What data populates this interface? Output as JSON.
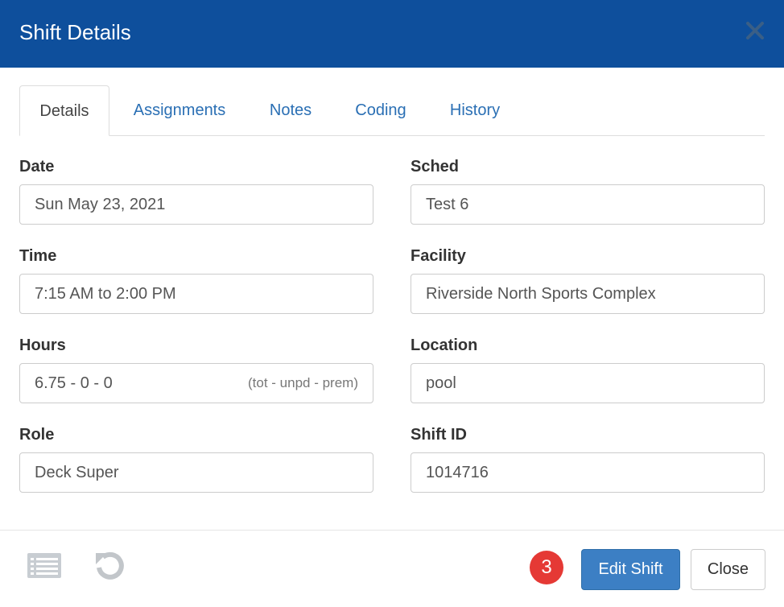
{
  "header": {
    "title": "Shift Details",
    "close_icon": "close-icon"
  },
  "tabs": [
    {
      "label": "Details",
      "active": true
    },
    {
      "label": "Assignments"
    },
    {
      "label": "Notes"
    },
    {
      "label": "Coding"
    },
    {
      "label": "History"
    }
  ],
  "fields": {
    "date": {
      "label": "Date",
      "value": "Sun May 23, 2021"
    },
    "time": {
      "label": "Time",
      "value": "7:15 AM to 2:00 PM"
    },
    "hours": {
      "label": "Hours",
      "value": "6.75 - 0 - 0",
      "hint": "(tot - unpd - prem)"
    },
    "role": {
      "label": "Role",
      "value": "Deck Super"
    },
    "sched": {
      "label": "Sched",
      "value": "Test 6"
    },
    "facility": {
      "label": "Facility",
      "value": "Riverside North Sports Complex"
    },
    "location": {
      "label": "Location",
      "value": "pool"
    },
    "shift_id": {
      "label": "Shift ID",
      "value": "1014716"
    }
  },
  "footer": {
    "left_icons": [
      "list-icon",
      "undo-icon"
    ],
    "badge_count": "3",
    "edit_label": "Edit Shift",
    "close_label": "Close"
  },
  "colors": {
    "header_bg": "#0e4f9c",
    "primary": "#3c7fc4",
    "link": "#2a6fb4",
    "badge": "#e53935"
  }
}
